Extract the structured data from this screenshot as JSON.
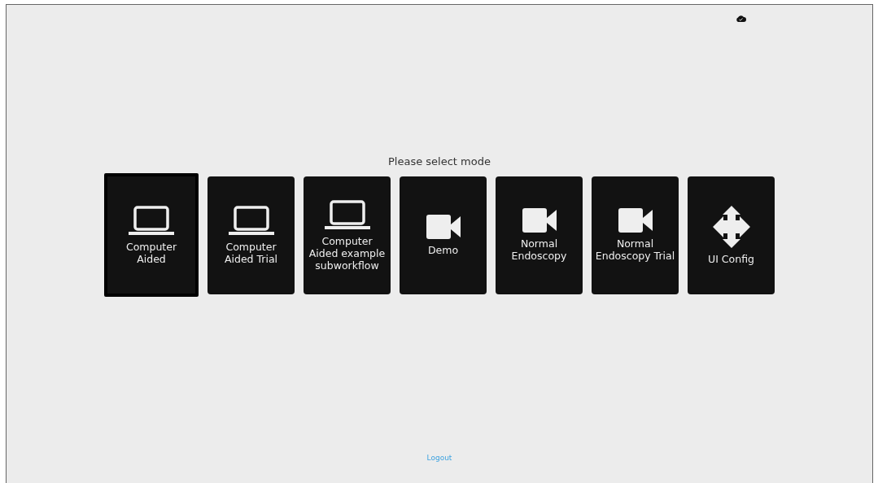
{
  "prompt": "Please select mode",
  "modes": [
    {
      "label": "Computer Aided",
      "kind": "laptop",
      "selected": true
    },
    {
      "label": "Computer Aided Trial",
      "kind": "laptop",
      "selected": false
    },
    {
      "label": "Computer Aided example subworkflow",
      "kind": "laptop",
      "selected": false
    },
    {
      "label": "Demo",
      "kind": "video",
      "selected": false
    },
    {
      "label": "Normal Endoscopy",
      "kind": "video",
      "selected": false
    },
    {
      "label": "Normal Endoscopy Trial",
      "kind": "video",
      "selected": false
    },
    {
      "label": "UI Config",
      "kind": "move",
      "selected": false
    }
  ],
  "logout": "Logout"
}
